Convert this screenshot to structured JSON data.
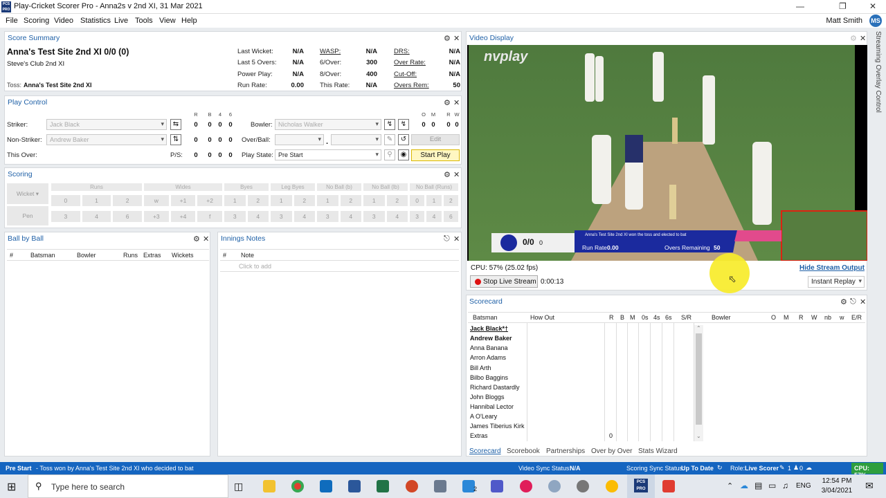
{
  "window": {
    "title": "Play-Cricket Scorer Pro - Anna2s v 2nd XI, 31 Mar 2021",
    "logo": "PCS PRO"
  },
  "menu": {
    "items": [
      "File",
      "Scoring",
      "Video",
      "Statistics",
      "Live",
      "Tools",
      "View",
      "Help"
    ],
    "user": "Matt Smith",
    "user_initials": "MS"
  },
  "score_summary": {
    "title": "Score Summary",
    "team_score": "Anna's Test Site 2nd XI 0/0 (0)",
    "opposition": "Steve's Club 2nd XI",
    "toss_label": "Toss:",
    "toss_value": "Anna's Test Site 2nd XI",
    "stats": [
      {
        "label": "Last Wicket:",
        "value": "N/A",
        "label2": "WASP:",
        "value2": "N/A",
        "label3": "DRS:",
        "value3": "N/A"
      },
      {
        "label": "Last 5 Overs:",
        "value": "N/A",
        "label2": "6/Over:",
        "value2": "300",
        "label3": "Over Rate:",
        "value3": "N/A"
      },
      {
        "label": "Power Play:",
        "value": "N/A",
        "label2": "8/Over:",
        "value2": "400",
        "label3": "Cut-Off:",
        "value3": "N/A"
      },
      {
        "label": "Run Rate:",
        "value": "0.00",
        "label2": "This Rate:",
        "value2": "N/A",
        "label3": "Overs Rem:",
        "value3": "50"
      }
    ]
  },
  "play_control": {
    "title": "Play Control",
    "striker_label": "Striker:",
    "striker": "Jack Black",
    "nonstriker_label": "Non-Striker:",
    "nonstriker": "Andrew Baker",
    "this_over_label": "This Over:",
    "ps_label": "P/S:",
    "bat_headers": [
      "R",
      "B",
      "4",
      "6"
    ],
    "bowl_headers": [
      "O",
      "M",
      "R",
      "W"
    ],
    "bowler_label": "Bowler:",
    "bowler": "Nicholas Walker",
    "overball_label": "Over/Ball:",
    "playstate_label": "Play State:",
    "playstate": "Pre Start",
    "edit": "Edit",
    "start": "Start Play",
    "zero": "0",
    "dot": "."
  },
  "scoring": {
    "title": "Scoring",
    "wicket": "Wicket",
    "pen": "Pen",
    "groups": [
      "Runs",
      "Wides",
      "Byes",
      "Leg Byes",
      "No Ball (b)",
      "No Ball (lb)",
      "No Ball (Runs)"
    ],
    "row1": [
      [
        "0",
        "1",
        "2"
      ],
      [
        "w",
        "+1",
        "+2"
      ],
      [
        "1",
        "2"
      ],
      [
        "1",
        "2"
      ],
      [
        "1",
        "2"
      ],
      [
        "1",
        "2"
      ],
      [
        "0",
        "1",
        "2"
      ]
    ],
    "row2": [
      [
        "3",
        "4",
        "6"
      ],
      [
        "+3",
        "+4",
        "f"
      ],
      [
        "3",
        "4"
      ],
      [
        "3",
        "4"
      ],
      [
        "3",
        "4"
      ],
      [
        "3",
        "4"
      ],
      [
        "3",
        "4",
        "6"
      ]
    ]
  },
  "ball_by_ball": {
    "title": "Ball by Ball",
    "columns": [
      "#",
      "Batsman",
      "Bowler",
      "Runs",
      "Extras",
      "Wickets"
    ]
  },
  "innings_notes": {
    "title": "Innings Notes",
    "columns": [
      "#",
      "Note"
    ],
    "placeholder": "Click to add"
  },
  "video": {
    "title": "Video Display",
    "brand": "nvplay",
    "score": "0/0",
    "overs": "0",
    "toss_msg": "Anna's Test Site 2nd XI won the toss and elected to bat",
    "run_rate_label": "Run Rate",
    "run_rate": "0.00",
    "overs_rem_label": "Overs Remaining",
    "overs_rem": "50",
    "cpu": "CPU: 57% (25.02 fps)",
    "hide_stream": "Hide Stream Output",
    "stop_stream": "Stop Live Stream",
    "elapsed": "0:00:13",
    "replay": "Instant Replay",
    "side_tab": "Streaming Overlay Control"
  },
  "scorecard": {
    "title": "Scorecard",
    "bat_columns": [
      "Batsman",
      "How Out",
      "R",
      "B",
      "M",
      "0s",
      "4s",
      "6s",
      "S/R"
    ],
    "bowl_columns": [
      "Bowler",
      "O",
      "M",
      "R",
      "W",
      "nb",
      "w",
      "E/R"
    ],
    "batsmen": [
      "Jack Black*†",
      "Andrew Baker",
      "Anna Banana",
      "Arron Adams",
      "Bill Arth",
      "Bilbo Baggins",
      "Richard Dastardly",
      "John Bloggs",
      "Hannibal Lector",
      "A O'Leary",
      "James Tiberius Kirk",
      "Extras"
    ],
    "extras_value": "0",
    "tabs": [
      "Scorecard",
      "Scorebook",
      "Partnerships",
      "Over by Over",
      "Stats Wizard"
    ]
  },
  "status": {
    "state": "Pre Start",
    "msg": "- Toss won by Anna's Test Site 2nd XI who decided to bat",
    "video_sync_label": "Video Sync Status:",
    "video_sync": "N/A",
    "scoring_sync_label": "Scoring Sync Status:",
    "scoring_sync": "Up To Date",
    "role_label": "Role:",
    "role": "Live Scorer",
    "count1": "1",
    "count2": "0",
    "cpu": "CPU: 57%"
  },
  "taskbar": {
    "search": "Type here to search",
    "lang": "ENG",
    "time": "12:54 PM",
    "date": "3/04/2021",
    "badge": "2"
  },
  "colors": {
    "accent": "#1d5fa6",
    "status_bar": "#1565c0",
    "cpu_badge": "#2e9e3e",
    "start_btn": "#fff7c2",
    "overlay_bar": "#1b2a9e",
    "overlay_pink": "#e24a8c"
  }
}
